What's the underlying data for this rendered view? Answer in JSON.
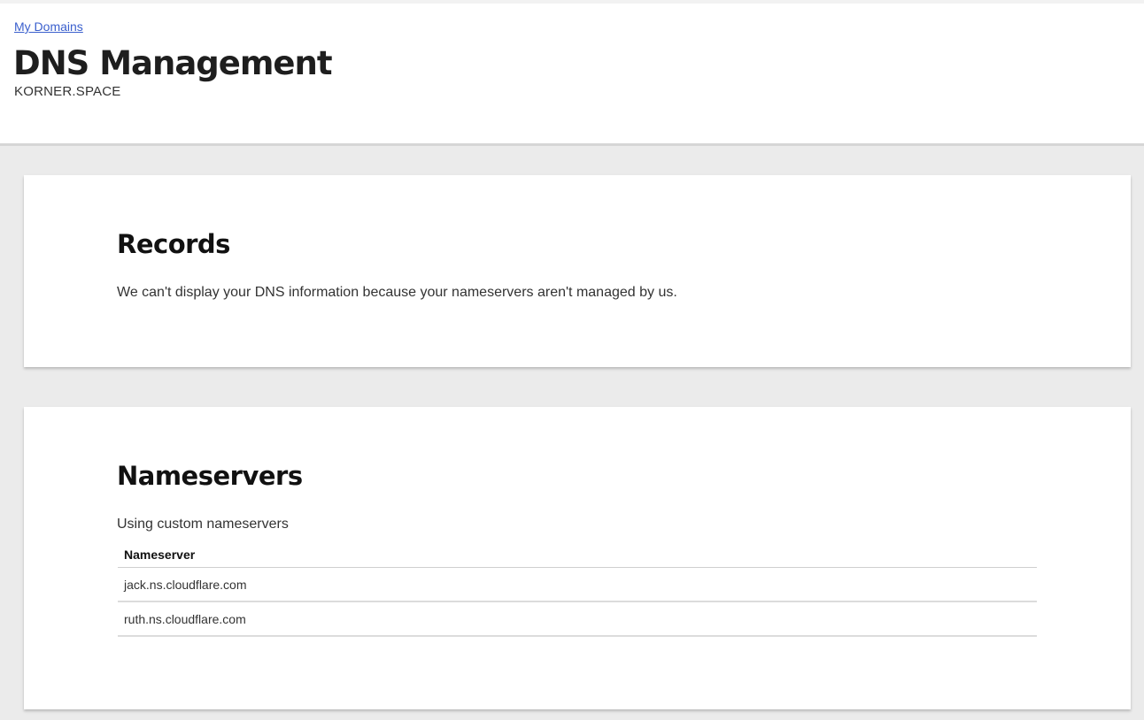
{
  "header": {
    "breadcrumb": "My Domains",
    "title": "DNS Management",
    "domain": "KORNER.SPACE"
  },
  "records": {
    "title": "Records",
    "message": "We can't display your DNS information because your nameservers aren't managed by us."
  },
  "nameservers": {
    "title": "Nameservers",
    "subtitle": "Using custom nameservers",
    "column_header": "Nameserver",
    "rows": [
      "jack.ns.cloudflare.com",
      "ruth.ns.cloudflare.com"
    ]
  },
  "colors": {
    "link": "#3a5fcd",
    "page_background": "#ebebeb",
    "card_background": "#ffffff"
  }
}
